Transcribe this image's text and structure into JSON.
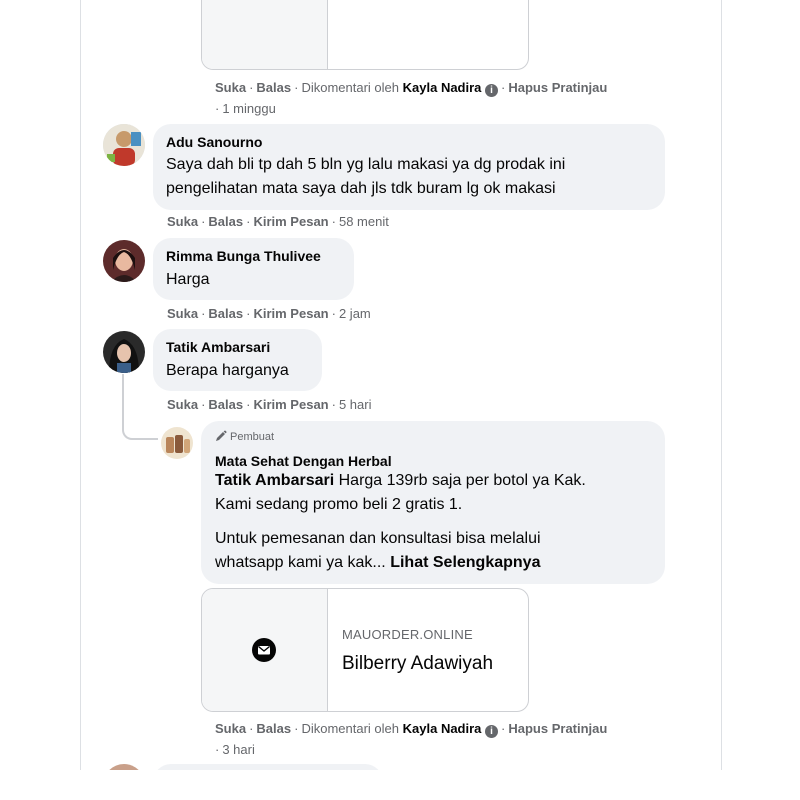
{
  "top_meta": {
    "like": "Suka",
    "reply": "Balas",
    "commented_by_prefix": "Dikomentari oleh",
    "commented_by_name": "Kayla Nadira",
    "info_glyph": "i",
    "remove_preview": "Hapus Pratinjau",
    "time": "1 minggu"
  },
  "comments": [
    {
      "name": "Adu Sanourno",
      "lines": [
        "Saya dah bli tp dah 5 bln yg lalu makasi ya dg prodak ini",
        "pengelihatan mata saya dah jls tdk buram lg ok makasi"
      ],
      "like": "Suka",
      "reply": "Balas",
      "message": "Kirim Pesan",
      "time": "58 menit"
    },
    {
      "name": "Rimma Bunga Thulivee",
      "lines": [
        "Harga"
      ],
      "like": "Suka",
      "reply": "Balas",
      "message": "Kirim Pesan",
      "time": "2 jam"
    },
    {
      "name": "Tatik Ambarsari",
      "lines": [
        "Berapa harganya"
      ],
      "like": "Suka",
      "reply": "Balas",
      "message": "Kirim Pesan",
      "time": "5 hari"
    }
  ],
  "reply": {
    "author_badge": "Pembuat",
    "page_name": "Mata Sehat Dengan Herbal",
    "mention": "Tatik Ambarsari",
    "line1_rest": "Harga 139rb saja per botol ya Kak.",
    "line2": "Kami sedang promo beli 2 gratis 1.",
    "line3": "Untuk pemesanan dan konsultasi bisa melalui",
    "line4": "whatsapp kami ya kak...",
    "see_more": "Lihat Selengkapnya",
    "link_domain": "MAUORDER.ONLINE",
    "link_title": "Bilberry Adawiyah",
    "meta": {
      "like": "Suka",
      "reply": "Balas",
      "commented_by_prefix": "Dikomentari oleh",
      "commented_by_name": "Kayla Nadira",
      "info_glyph": "i",
      "remove_preview": "Hapus Pratinjau",
      "time": "3 hari"
    }
  },
  "colors": {
    "bubble": "#f0f2f5",
    "meta_text": "#65676b",
    "primary_text": "#050505"
  },
  "icons": [
    "pencil-icon",
    "envelope-icon",
    "info-icon"
  ]
}
